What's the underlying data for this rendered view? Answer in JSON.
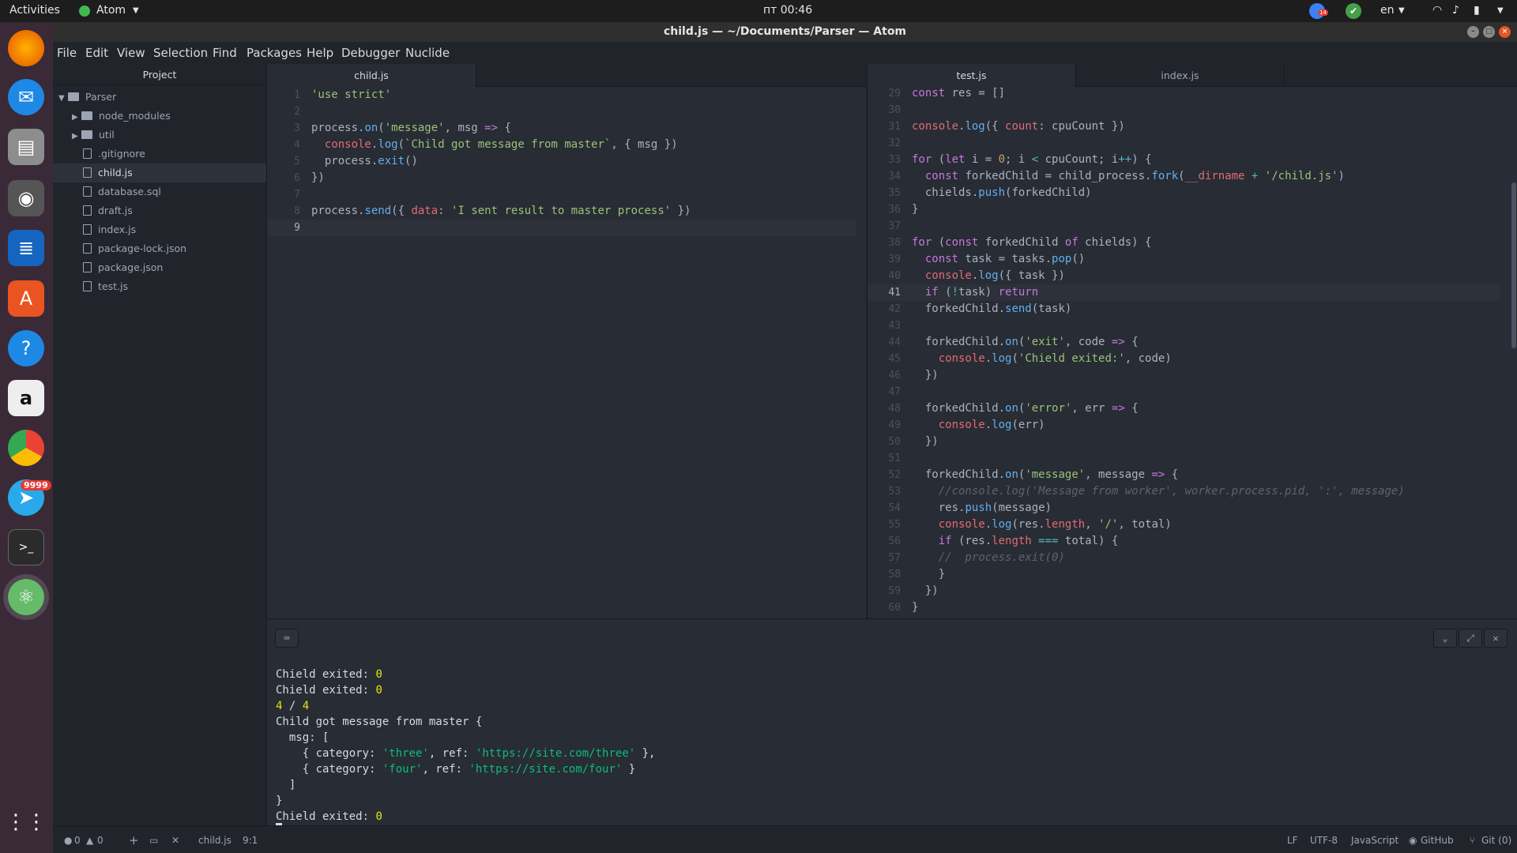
{
  "topbar": {
    "activities": "Activities",
    "app_menu": "Atom",
    "clock": "пт 00:46",
    "lang": "en",
    "badge_count": "14"
  },
  "window": {
    "title": "child.js — ~/Documents/Parser — Atom"
  },
  "menubar": {
    "items": [
      "File",
      "Edit",
      "View",
      "Selection",
      "Find",
      "Packages",
      "Help",
      "Debugger",
      "Nuclide"
    ]
  },
  "dock": {
    "telegram_badge": "9999"
  },
  "tree": {
    "header": "Project",
    "root": "Parser",
    "items": [
      "node_modules",
      "util",
      ".gitignore",
      "child.js",
      "database.sql",
      "draft.js",
      "index.js",
      "package-lock.json",
      "package.json",
      "test.js"
    ]
  },
  "left_pane": {
    "tab": "child.js"
  },
  "right_pane": {
    "tabs": [
      "test.js",
      "index.js"
    ]
  },
  "status": {
    "errors": "0",
    "warnings": "0",
    "file": "child.js",
    "cursor": "9:1",
    "eol": "LF",
    "encoding": "UTF-8",
    "grammar": "JavaScript",
    "github": "GitHub",
    "git": "Git (0)"
  },
  "colors": {
    "accent_orange": "#e95420",
    "editor_bg": "#282c34"
  }
}
